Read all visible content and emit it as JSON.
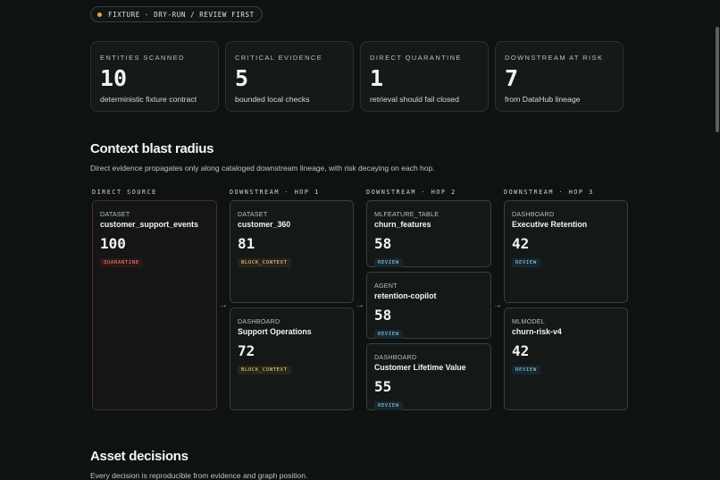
{
  "pill": {
    "text": "FIXTURE · DRY-RUN / REVIEW FIRST"
  },
  "stats": [
    {
      "label": "ENTITIES SCANNED",
      "value": "10",
      "desc": "deterministic fixture contract"
    },
    {
      "label": "CRITICAL EVIDENCE",
      "value": "5",
      "desc": "bounded local checks"
    },
    {
      "label": "DIRECT QUARANTINE",
      "value": "1",
      "desc": "retrieval should fail closed"
    },
    {
      "label": "DOWNSTREAM AT RISK",
      "value": "7",
      "desc": "from DataHub lineage"
    }
  ],
  "blast": {
    "title": "Context blast radius",
    "subtitle": "Direct evidence propagates only along cataloged downstream lineage, with risk decaying on each hop.",
    "columns": [
      "DIRECT SOURCE",
      "DOWNSTREAM · HOP 1",
      "DOWNSTREAM · HOP 2",
      "DOWNSTREAM · HOP 3"
    ],
    "nodes": {
      "src": {
        "kind": "DATASET",
        "name": "customer_support_events",
        "score": "100",
        "badge": "QUARANTINE"
      },
      "h1a": {
        "kind": "DATASET",
        "name": "customer_360",
        "score": "81",
        "badge": "BLOCK_CONTEXT"
      },
      "h1b": {
        "kind": "DASHBOARD",
        "name": "Support Operations",
        "score": "72",
        "badge": "BLOCK_CONTEXT"
      },
      "h2a": {
        "kind": "MLFEATURE_TABLE",
        "name": "churn_features",
        "score": "58",
        "badge": "REVIEW"
      },
      "h2b": {
        "kind": "AGENT",
        "name": "retention-copilot",
        "score": "58",
        "badge": "REVIEW"
      },
      "h2c": {
        "kind": "DASHBOARD",
        "name": "Customer Lifetime Value",
        "score": "55",
        "badge": "REVIEW"
      },
      "h3a": {
        "kind": "DASHBOARD",
        "name": "Executive Retention",
        "score": "42",
        "badge": "REVIEW"
      },
      "h3b": {
        "kind": "MLMODEL",
        "name": "churn-risk-v4",
        "score": "42",
        "badge": "REVIEW"
      }
    },
    "arrow": "→"
  },
  "decisions": {
    "title": "Asset decisions",
    "subtitle": "Every decision is reproducible from evidence and graph position."
  }
}
